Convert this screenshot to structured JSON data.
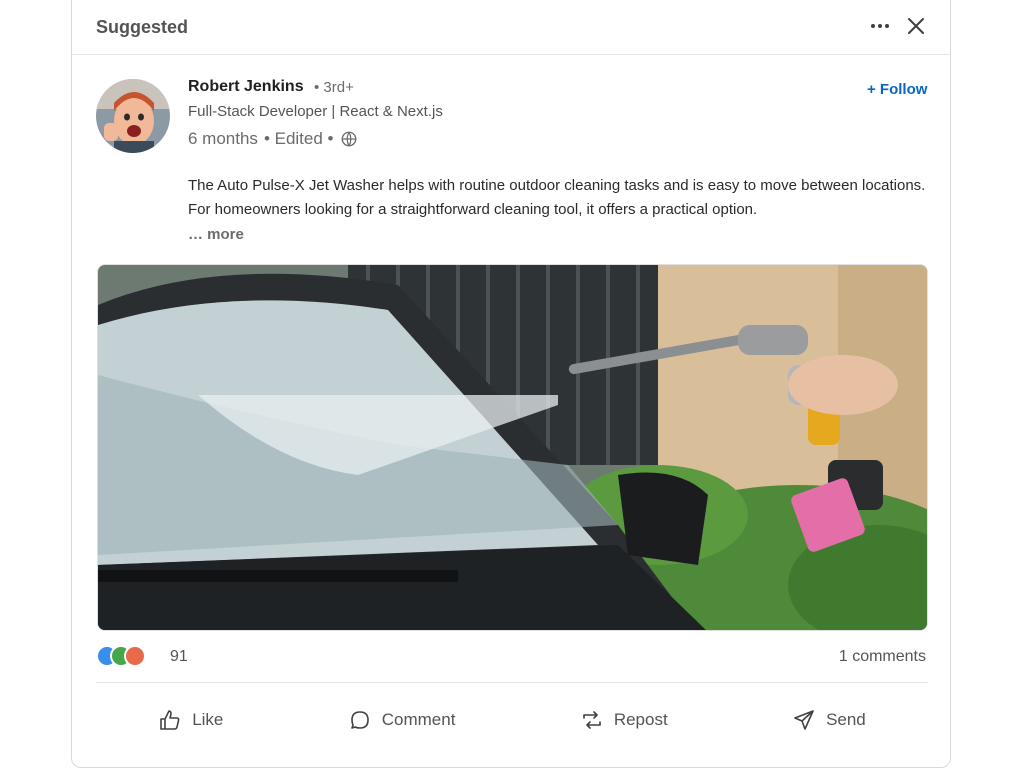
{
  "header": {
    "title": "Suggested",
    "more_icon": "more-horizontal-icon",
    "close_icon": "close-icon"
  },
  "author": {
    "name": "Robert Jenkins",
    "degree": "• 3rd+",
    "headline": "Full-Stack Developer | React & Next.js",
    "time": "6 months",
    "edited": "• Edited •",
    "visibility_icon": "globe-icon"
  },
  "follow_label": "+ Follow",
  "post": {
    "text": "The Auto Pulse-X Jet Washer helps with routine outdoor cleaning tasks and is easy to move between locations. For homeowners looking for a straightforward cleaning tool, it offers a practical option.",
    "more": "… more"
  },
  "social": {
    "reactions_count": "91",
    "comments": "1 comments",
    "reaction_icons": [
      "like-icon",
      "celebrate-icon",
      "love-icon"
    ]
  },
  "actions": {
    "like": "Like",
    "comment": "Comment",
    "repost": "Repost",
    "send": "Send"
  },
  "colors": {
    "accent": "#0a66c2",
    "text_secondary": "#545454"
  }
}
